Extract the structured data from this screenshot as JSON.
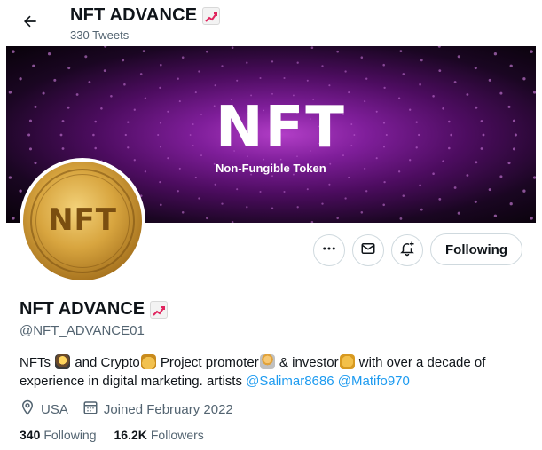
{
  "header": {
    "title": "NFT ADVANCE",
    "tweet_count": "330 Tweets",
    "back_icon": "arrow-left-icon",
    "title_emoji": "chart-increasing-emoji"
  },
  "banner": {
    "headline": "NFT",
    "subtitle": "Non-Fungible Token",
    "colors": {
      "glow": "#b23ec7",
      "edge": "#080209"
    }
  },
  "avatar": {
    "text": "NFT",
    "ring_text": "NFT Fungible Token",
    "color": "#d8a53f"
  },
  "actions": {
    "more_icon": "more-icon",
    "message_icon": "mail-icon",
    "notify_icon": "bell-plus-icon",
    "follow_label": "Following"
  },
  "profile": {
    "name": "NFT ADVANCE",
    "handle": "@NFT_ADVANCE01",
    "bio": {
      "part1": "NFTs ",
      "part2": " and Crypto",
      "part3": " Project promoter",
      "part4": " & investor",
      "part5": " with over a decade of experience in digital marketing. artists ",
      "mention1": "@Salimar8686",
      "mention2": "@Matifo970"
    },
    "location": "USA",
    "joined": "Joined February 2022"
  },
  "stats": {
    "following_count": "340",
    "following_label": "Following",
    "followers_count": "16.2K",
    "followers_label": "Followers"
  },
  "colors": {
    "link": "#1d9bf0",
    "secondary_text": "#536471",
    "border": "#cfd9de"
  }
}
